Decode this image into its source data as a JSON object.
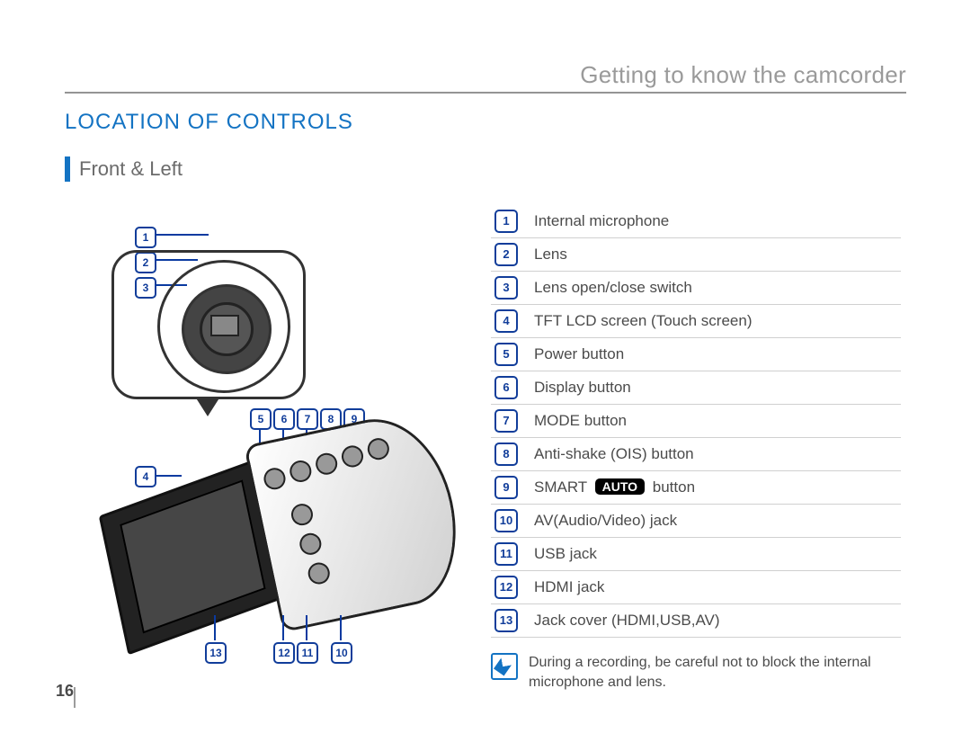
{
  "chapter_title": "Getting to know the camcorder",
  "section_heading": "LOCATION OF CONTROLS",
  "subsection": "Front & Left",
  "page_number": "16",
  "controls": [
    {
      "n": "1",
      "label": "Internal microphone"
    },
    {
      "n": "2",
      "label": "Lens"
    },
    {
      "n": "3",
      "label": "Lens open/close switch"
    },
    {
      "n": "4",
      "label": "TFT LCD screen (Touch screen)"
    },
    {
      "n": "5",
      "label": "Power button"
    },
    {
      "n": "6",
      "label": "Display button"
    },
    {
      "n": "7",
      "label": "MODE button"
    },
    {
      "n": "8",
      "label": "Anti-shake (OIS) button"
    },
    {
      "n": "9",
      "label_pre": "SMART ",
      "pill": "AUTO",
      "label_post": " button"
    },
    {
      "n": "10",
      "label": "AV(Audio/Video) jack"
    },
    {
      "n": "11",
      "label": "USB jack"
    },
    {
      "n": "12",
      "label": "HDMI jack"
    },
    {
      "n": "13",
      "label": "Jack cover (HDMI,USB,AV)"
    }
  ],
  "note_text": "During a recording, be careful not to block the internal microphone and lens.",
  "diagram_callouts": {
    "lens_area": [
      "1",
      "2",
      "3"
    ],
    "top_row": [
      "5",
      "6",
      "7",
      "8",
      "9"
    ],
    "lcd": [
      "4"
    ],
    "bottom_row": [
      "13",
      "12",
      "11",
      "10"
    ]
  }
}
